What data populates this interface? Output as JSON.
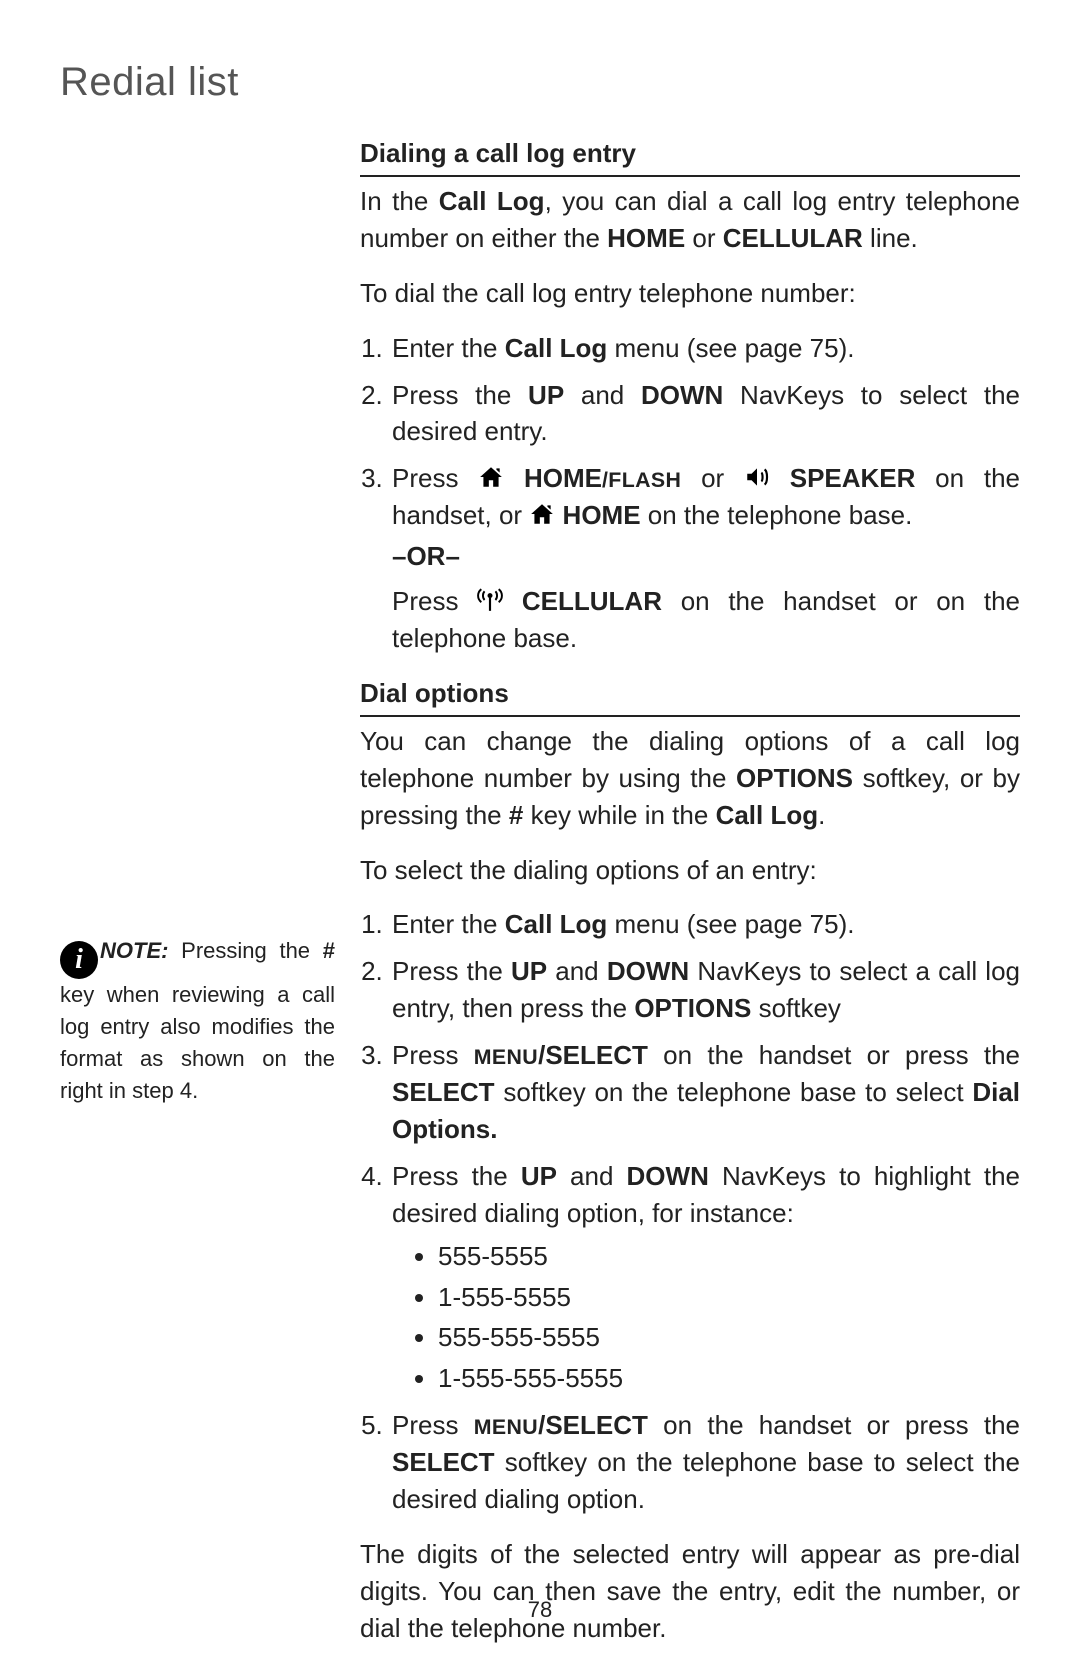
{
  "page_title": "Redial list",
  "page_number": "78",
  "sidebar": {
    "note_label": "NOTE:",
    "note_prefix": " Pressing the ",
    "note_hash": "#",
    "note_rest": " key when reviewing a call log entry also modifies the format as shown on the right in step 4."
  },
  "section1": {
    "heading": "Dialing a call log entry",
    "intro_1": "In the ",
    "intro_b1": "Call Log",
    "intro_2": ", you can dial a call log entry telephone number on either the ",
    "intro_b2": "HOME",
    "intro_3": " or ",
    "intro_b3": "CELLULAR",
    "intro_4": " line.",
    "lead": "To dial the call log entry telephone number:",
    "step1_a": "Enter the ",
    "step1_b": "Call Log",
    "step1_c": " menu (see page 75).",
    "step2_a": "Press the ",
    "step2_b": "UP",
    "step2_c": " and ",
    "step2_d": "DOWN",
    "step2_e": " NavKeys to select the desired entry.",
    "step3_a": "Press ",
    "step3_home": " HOME",
    "step3_flash": "/FLASH",
    "step3_or": " or ",
    "step3_speaker": " SPEAKER",
    "step3_b": " on the handset, or ",
    "step3_home2": " HOME",
    "step3_c": " on the telephone base.",
    "or": "–OR–",
    "step3_alt_a": "Press ",
    "step3_alt_cell": " CELLULAR",
    "step3_alt_b": " on the handset or on the telephone base."
  },
  "section2": {
    "heading": "Dial options",
    "intro_a": "You can change the dialing options of a call log telephone number by using the ",
    "intro_b1": "OPTIONS",
    "intro_b": " softkey, or by pressing the ",
    "intro_hash": "#",
    "intro_c": " key while in the ",
    "intro_b2": "Call Log",
    "intro_d": ".",
    "lead": "To select the dialing options of an entry:",
    "step1_a": "Enter the ",
    "step1_b": "Call Log",
    "step1_c": " menu (see page 75).",
    "step2_a": "Press the ",
    "step2_b": "UP",
    "step2_c": " and ",
    "step2_d": "DOWN",
    "step2_e": " NavKeys to select a call log entry, then press the ",
    "step2_f": "OPTIONS",
    "step2_g": " softkey",
    "step3_a": "Press ",
    "step3_menu": "MENU",
    "step3_select": "/SELECT",
    "step3_b": " on the handset or press the ",
    "step3_select2": "SELECT",
    "step3_c": " softkey on the telephone base to select ",
    "step3_d": "Dial Options.",
    "step4_a": "Press the ",
    "step4_b": "UP",
    "step4_c": " and ",
    "step4_d": "DOWN",
    "step4_e": " NavKeys to highlight the desired dialing option, for instance:",
    "options": [
      "555-5555",
      "1-555-5555",
      "555-555-5555",
      "1-555-555-5555"
    ],
    "step5_a": "Press ",
    "step5_menu": "MENU",
    "step5_select": "/SELECT",
    "step5_b": " on the handset or press the ",
    "step5_select2": "SELECT",
    "step5_c": " softkey on the telephone base to select the desired dialing option.",
    "closing": "The digits of the selected entry will appear as pre-dial digits. You can then save the entry, edit the number, or dial the telephone number."
  }
}
